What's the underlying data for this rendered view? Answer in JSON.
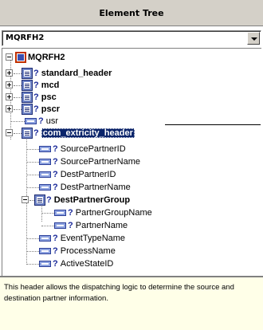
{
  "header": {
    "title": "Element Tree"
  },
  "combo": {
    "value": "MQRFH2"
  },
  "tree": {
    "root": "MQRFH2",
    "standard_header": "standard_header",
    "mcd": "mcd",
    "psc": "psc",
    "pscr": "pscr",
    "usr": "usr",
    "selected": "com_extricity_header",
    "source_partner_id": "SourcePartnerID",
    "source_partner_name": "SourcePartnerName",
    "dest_partner_id": "DestPartnerID",
    "dest_partner_name": "DestPartnerName",
    "dest_partner_group": "DestPartnerGroup",
    "partner_group_name": "PartnerGroupName",
    "partner_name": "PartnerName",
    "event_type_name": "EventTypeName",
    "process_name": "ProcessName",
    "active_state_id": "ActiveStateID",
    "qmark": "?"
  },
  "description": "This header allows the dispatching logic to determine the source and destination partner information."
}
